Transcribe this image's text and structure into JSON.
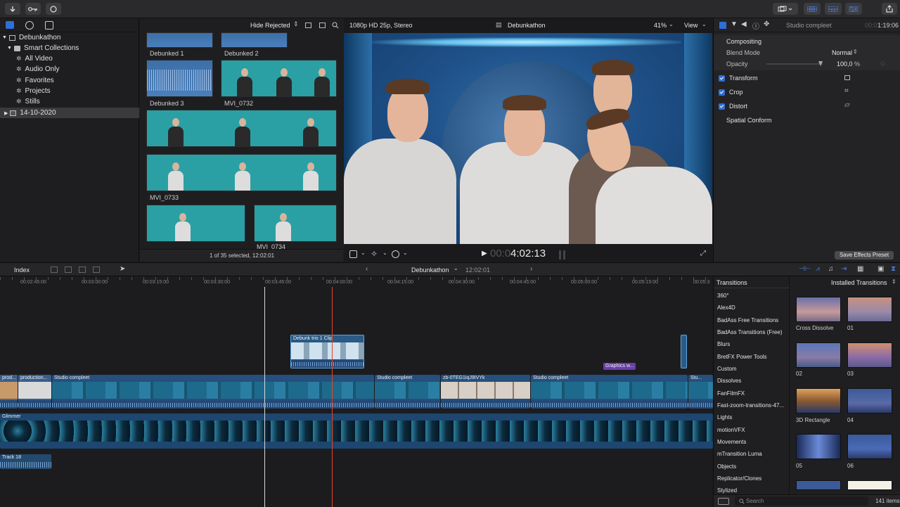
{
  "toolbar": {
    "share_icon": "share-icon",
    "colors": {
      "accent": "#2f6fd6"
    }
  },
  "library": {
    "items": [
      {
        "label": "Debunkathon",
        "level": 0
      },
      {
        "label": "Smart Collections",
        "level": 1
      },
      {
        "label": "All Video",
        "level": 2
      },
      {
        "label": "Audio Only",
        "level": 2
      },
      {
        "label": "Favorites",
        "level": 2
      },
      {
        "label": "Projects",
        "level": 2
      },
      {
        "label": "Stills",
        "level": 2
      },
      {
        "label": "14-10-2020",
        "level": 0
      }
    ]
  },
  "browser": {
    "filter": "Hide Rejected",
    "clips": [
      "Debunked 1",
      "Debunked 2",
      "Debunked 3",
      "MVI_0732",
      "MVI_0733",
      "MVI_0734"
    ],
    "status": "1 of 35 selected, 12:02:01"
  },
  "viewer": {
    "format": "1080p HD 25p, Stereo",
    "project": "Debunkathon",
    "zoom": "41%",
    "view_label": "View",
    "timecode_dim": "00:0",
    "timecode": "4:02:13"
  },
  "inspector": {
    "clip_name": "Studio compleet",
    "duration_dim": "00:0",
    "duration": "1:19:06",
    "compositing": "Compositing",
    "blend_mode_label": "Blend Mode",
    "blend_mode_value": "Normal",
    "opacity_label": "Opacity",
    "opacity_value": "100,0",
    "opacity_unit": "%",
    "effects": [
      "Transform",
      "Crop",
      "Distort"
    ],
    "spatial_conform": "Spatial Conform",
    "save_preset": "Save Effects Preset"
  },
  "timeline": {
    "index_label": "Index",
    "project": "Debunkathon",
    "duration": "12:02:01",
    "ruler": [
      "00:02:45:00",
      "00:03:00:00",
      "00:03:15:00",
      "00:03:30:00",
      "00:03:45:00",
      "00:04:00:00",
      "00:04:15:00",
      "00:04:30:00",
      "00:04:45:00",
      "00:05:00:00",
      "00:05:15:00",
      "00:05:3"
    ],
    "clips": {
      "connected": "Debunk trio 1 Clip",
      "title": "Graphics w...",
      "prod1": "prod...",
      "prod2": "production...",
      "studio1": "Studio compleet",
      "studio2": "Studio compleet",
      "zb": "zb-0TEG1iqJ9IVYk",
      "studio3": "Studio compleet",
      "studio4": "Stu...",
      "glimmer": "Glimmer",
      "track18": "Track 18"
    }
  },
  "transitions": {
    "title": "Transitions",
    "installed": "Installed Transitions",
    "categories": [
      "360°",
      "Alex4D",
      "BadAss Free Transitions",
      "BadAss Transitions (Free)",
      "Blurs",
      "BretFX Power Tools",
      "Custom",
      "Dissolves",
      "FanFilmFX",
      "Fast-zoom-transitions-47...",
      "Lights",
      "motionVFX",
      "Movements",
      "mTransition Luma",
      "Objects",
      "Replicator/Clones",
      "Stylized"
    ],
    "items": [
      "Cross Dissolve",
      "01",
      "02",
      "03",
      "3D Rectangle",
      "04",
      "05",
      "06"
    ],
    "search_placeholder": "Search",
    "count": "141 items"
  }
}
